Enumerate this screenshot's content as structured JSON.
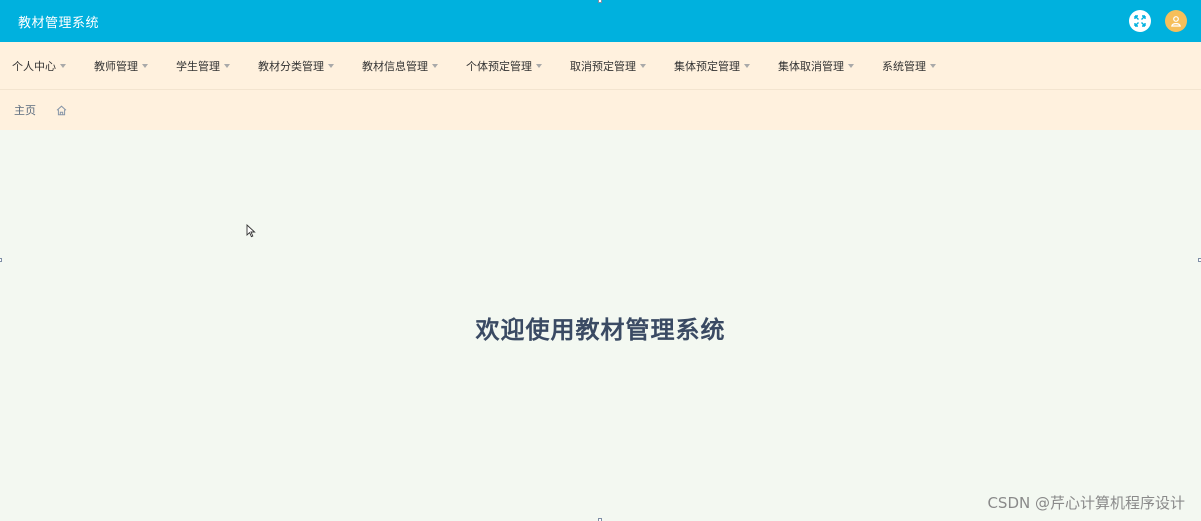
{
  "header": {
    "title": "教材管理系统",
    "bg_color": "#00b1de",
    "actions": [
      {
        "name": "fullscreen",
        "icon": "expand-icon"
      },
      {
        "name": "user",
        "icon": "user-icon"
      }
    ]
  },
  "menu": {
    "items": [
      {
        "label": "个人中心"
      },
      {
        "label": "教师管理"
      },
      {
        "label": "学生管理"
      },
      {
        "label": "教材分类管理"
      },
      {
        "label": "教材信息管理"
      },
      {
        "label": "个体预定管理"
      },
      {
        "label": "取消预定管理"
      },
      {
        "label": "集体预定管理"
      },
      {
        "label": "集体取消管理"
      },
      {
        "label": "系统管理"
      }
    ]
  },
  "breadcrumb": {
    "home_label": "主页",
    "home_icon": "home-icon"
  },
  "main": {
    "welcome_text": "欢迎使用教材管理系统"
  },
  "watermark": "CSDN @芹心计算机程序设计",
  "colors": {
    "menu_bg": "#fff1de",
    "content_bg": "#f3f8f1",
    "welcome": "#3a4a63"
  }
}
